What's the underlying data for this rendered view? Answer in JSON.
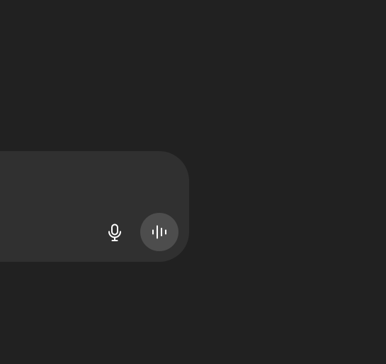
{
  "composer": {
    "buttons": {
      "dictate": {
        "icon": "microphone-icon"
      },
      "voice_mode": {
        "icon": "waveform-icon"
      }
    }
  },
  "colors": {
    "page_background": "#212121",
    "composer_background": "#303030",
    "voice_button_background": "#4d4d4d",
    "icon": "#ffffff"
  }
}
